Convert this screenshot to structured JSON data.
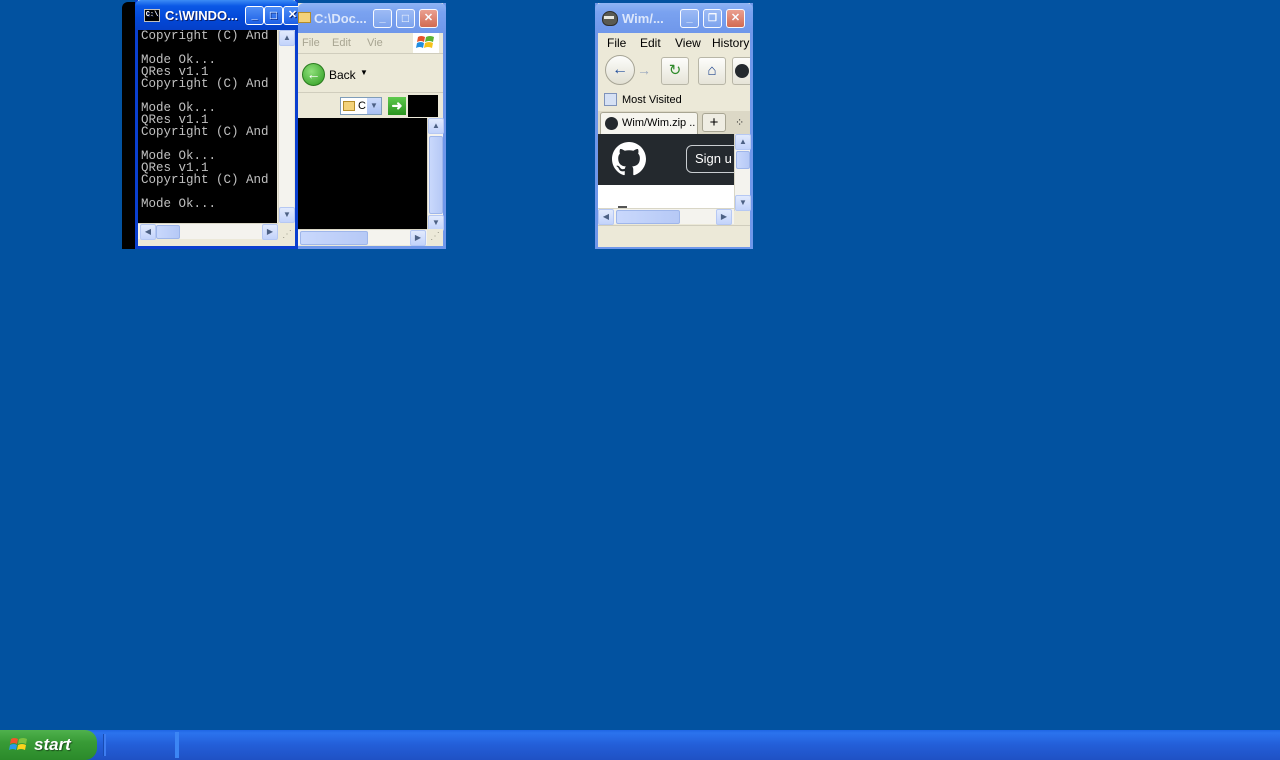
{
  "console": {
    "title": "C:\\WINDO...",
    "icon": "console-icon",
    "lines": [
      "Copyright (C) And",
      "",
      "Mode Ok...",
      "QRes v1.1",
      "Copyright (C) And",
      "",
      "Mode Ok...",
      "QRes v1.1",
      "Copyright (C) And",
      "",
      "Mode Ok...",
      "QRes v1.1",
      "Copyright (C) And",
      "",
      "Mode Ok..."
    ]
  },
  "explorer": {
    "title": "C:\\Doc...",
    "menu": [
      "File",
      "Edit",
      "Vie"
    ],
    "back_label": "Back",
    "address_text": "C"
  },
  "firefox": {
    "title": "Wim/...",
    "menu": [
      "File",
      "Edit",
      "View",
      "History"
    ],
    "bookmark": "Most Visited",
    "tab_label": "Wim/Wim.zip ...",
    "new_tab": "+",
    "signup_label": "Sign u"
  },
  "taskbar": {
    "start_label": "start"
  },
  "colors": {
    "desktop": "#0252a0",
    "titlebar_active": "#0248d8",
    "titlebar_inactive": "#7aa2f0",
    "github_header": "#24292e",
    "start_green": "#389b36"
  }
}
